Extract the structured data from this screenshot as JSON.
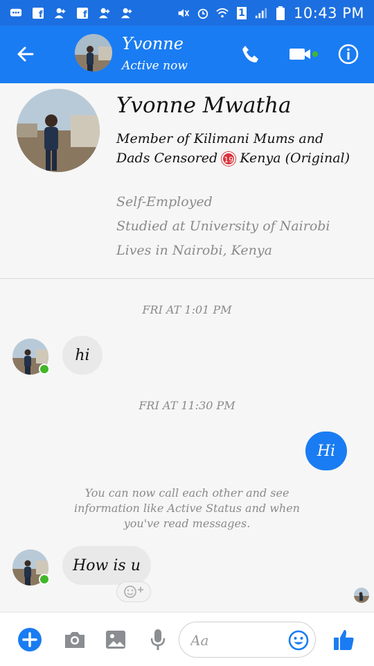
{
  "status_bar": {
    "time": "10:43 PM",
    "battery": "1"
  },
  "header": {
    "name": "Yvonne",
    "status": "Active now"
  },
  "profile": {
    "full_name": "Yvonne Mwatha",
    "member_prefix": "Member of Kilimani Mums and Dads Censored",
    "member_badge": "19",
    "member_suffix": "Kenya (Original)",
    "work": "Self-Employed",
    "education": "Studied at University of Nairobi",
    "location": "Lives in Nairobi, Kenya"
  },
  "messages": {
    "ts1": "FRI AT 1:01 PM",
    "msg1": "hi",
    "ts2": "FRI AT 11:30 PM",
    "msg2": "Hi",
    "notice": "You can now call each other and see information like Active Status and when you've read messages.",
    "msg3": "How is u"
  },
  "composer": {
    "placeholder": "Aa"
  },
  "colors": {
    "brand_blue": "#1a7cf2",
    "status_bar_blue": "#1c6fe0",
    "online_green": "#42b72a",
    "bubble_gray": "#e9e9e9"
  },
  "icons": {
    "header": [
      "back-arrow-icon",
      "phone-icon",
      "video-camera-icon",
      "info-icon"
    ],
    "composer": [
      "plus-icon",
      "camera-icon",
      "image-icon",
      "microphone-icon",
      "emoji-icon",
      "thumbs-up-icon"
    ]
  }
}
